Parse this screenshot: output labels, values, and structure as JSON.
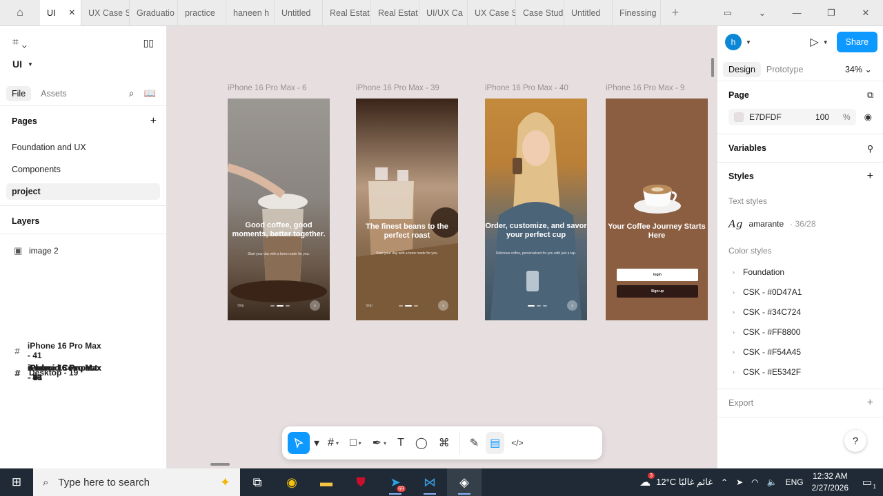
{
  "tabs": {
    "active": "UI",
    "items": [
      "UX Case S",
      "Graduatio",
      "practice",
      "haneen h",
      "Untitled",
      "Real Estat",
      "Real Estat",
      "UI/UX Ca",
      "UX Case S",
      "Case Stud",
      "Untitled",
      "Finessing"
    ]
  },
  "left": {
    "project": "UI",
    "file_tab": "File",
    "assets_tab": "Assets",
    "pages_title": "Pages",
    "pages": [
      "Foundation and UX",
      "Components",
      "project"
    ],
    "layers_title": "Layers",
    "layers": [
      {
        "name": "iPhone 16 Pro Max - 41",
        "icon": "frame"
      },
      {
        "name": "image 2",
        "icon": "image"
      },
      {
        "name": "iPhone 16 Pro Max - 9",
        "icon": "frame"
      },
      {
        "name": "iPhone 16 Pro Max - 40",
        "icon": "frame"
      },
      {
        "name": "iPhone 16 Pro Max - 39",
        "icon": "frame"
      },
      {
        "name": "iPhone 16 Pro Max - 6",
        "icon": "frame"
      },
      {
        "name": "Android Compact - 43",
        "icon": "frame"
      },
      {
        "name": "Android Compact - 5",
        "icon": "frame"
      },
      {
        "name": "Android Compact - 41",
        "icon": "frame"
      },
      {
        "name": "Desktop - 19",
        "icon": "frame"
      }
    ]
  },
  "canvas": {
    "frames": [
      {
        "label": "iPhone 16 Pro Max - 6",
        "headline": "Good coffee, good moments, better together.",
        "sub": "Start your day with a brew made for you.",
        "skip": "Skip"
      },
      {
        "label": "iPhone 16 Pro Max - 39",
        "headline": "The finest beans to the perfect roast",
        "sub": "Start your day with a brew made for you.",
        "skip": "Skip"
      },
      {
        "label": "iPhone 16 Pro Max - 40",
        "headline": "Order, customize, and savor your perfect cup",
        "sub": "Delicious coffee, personalized for you with just a tap.",
        "skip": ""
      },
      {
        "label": "iPhone 16 Pro Max - 9",
        "headline": "Your Coffee Journey Starts Here",
        "login": "login",
        "signup": "Sign up"
      }
    ]
  },
  "right": {
    "avatar": "h",
    "share": "Share",
    "design_tab": "Design",
    "prototype_tab": "Prototype",
    "zoom": "34%",
    "page_title": "Page",
    "page_color": "E7DFDF",
    "page_opacity": "100",
    "page_opacity_unit": "%",
    "variables_title": "Variables",
    "styles_title": "Styles",
    "text_styles_title": "Text styles",
    "text_style": {
      "sample": "Ag",
      "name": "amarante",
      "meta": "· 36/28"
    },
    "color_styles_title": "Color styles",
    "color_styles": [
      "Foundation",
      "CSK - #0D47A1",
      "CSK - #34C724",
      "CSK - #FF8800",
      "CSK - #F54A45",
      "CSK - #E5342F"
    ],
    "export_title": "Export"
  },
  "taskbar": {
    "search_placeholder": "Type here to search",
    "weather_badge": "3",
    "weather": "12°C غائم غالبًا",
    "lang": "ENG",
    "time": "12:32 AM",
    "date": "2/27/2026",
    "notif_count": "1",
    "telegram_badge": "69"
  },
  "colors": {
    "accent": "#0d99ff",
    "page_bg": "#e7dfdf",
    "taskbar": "#1f2a36"
  }
}
